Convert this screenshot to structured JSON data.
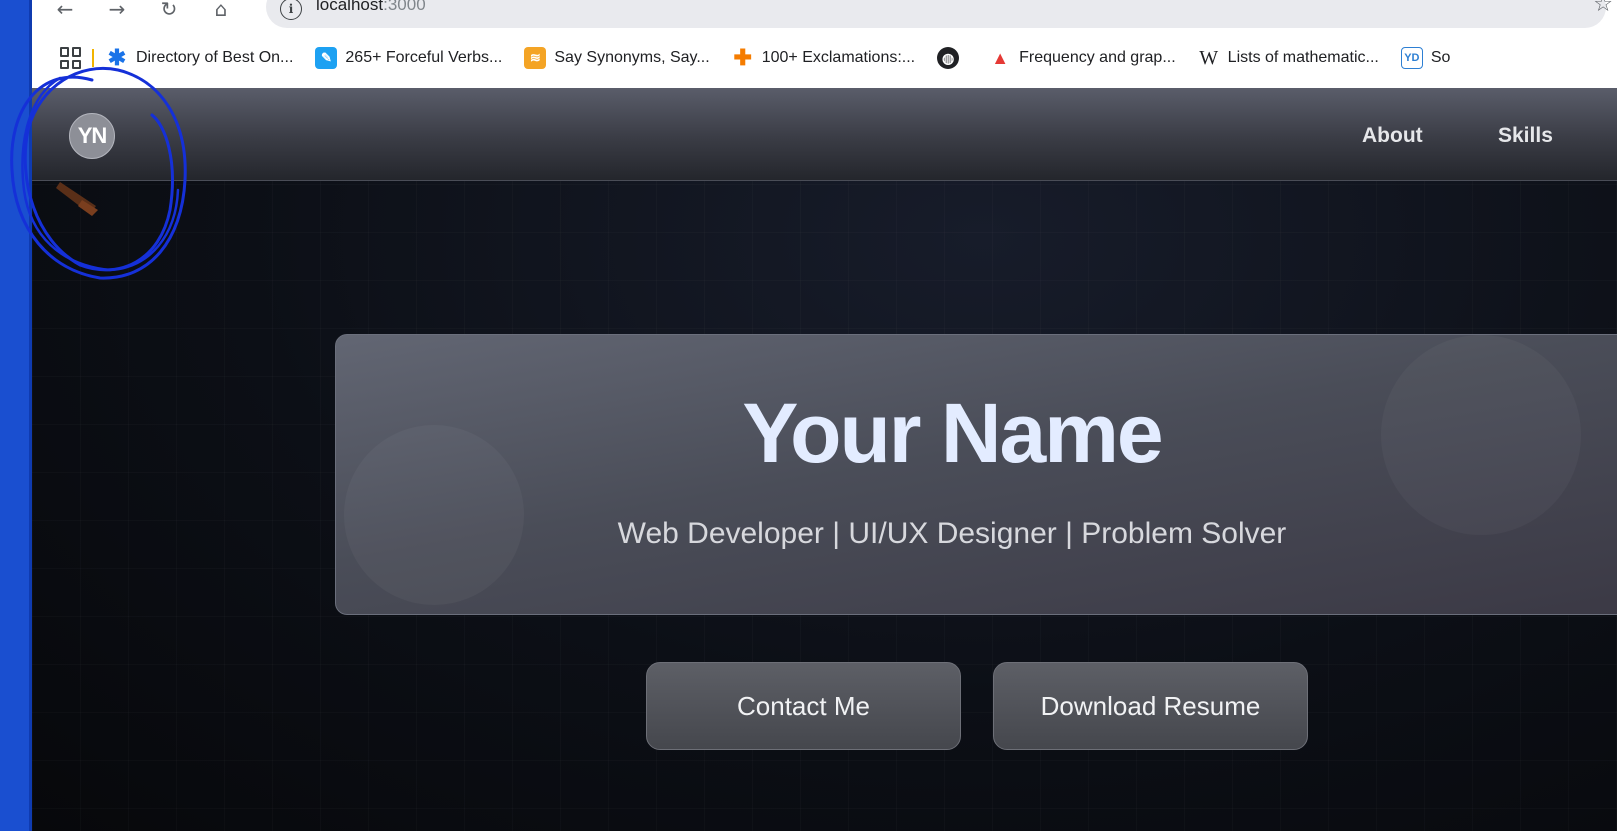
{
  "browser": {
    "url_host": "localhost",
    "url_port": ":3000",
    "bookmarks": [
      {
        "label": "Directory of Best On...",
        "icon": "asterisk-icon",
        "color": "#1a73e8"
      },
      {
        "label": "265+ Forceful Verbs...",
        "icon": "quill-icon",
        "color": "#1da1f2"
      },
      {
        "label": "Say Synonyms, Say...",
        "icon": "stack-icon",
        "color": "#f4a425"
      },
      {
        "label": "100+ Exclamations:...",
        "icon": "cross-icon",
        "color": "#f57c00"
      },
      {
        "label": "",
        "icon": "globe-icon",
        "color": "#202124"
      },
      {
        "label": "Frequency and grap...",
        "icon": "triangle-icon",
        "color": "#e53935"
      },
      {
        "label": "Lists of mathematic...",
        "icon": "wikipedia-icon",
        "color": "#202124"
      },
      {
        "label": "So",
        "icon": "yd-icon",
        "color": "#2d7fd3"
      }
    ]
  },
  "nav": {
    "logo": "YN",
    "links": [
      "About",
      "Skills"
    ]
  },
  "hero": {
    "name": "Your Name",
    "tagline": "Web Developer | UI/UX Designer | Problem Solver"
  },
  "actions": {
    "contact": "Contact Me",
    "resume": "Download Resume"
  },
  "colors": {
    "annotation": "#1530d8",
    "hero_title": "#e3ecff",
    "left_strip": "#1a4fd0"
  }
}
